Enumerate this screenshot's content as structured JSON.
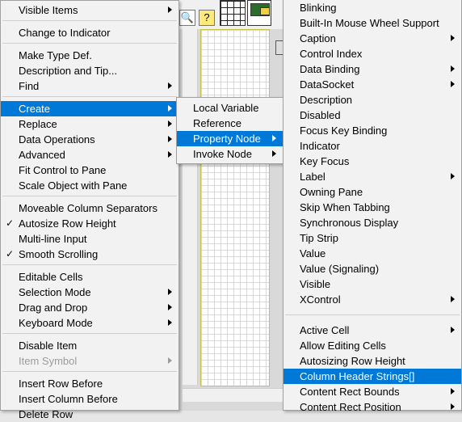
{
  "main_menu": {
    "items": [
      {
        "label": "Visible Items",
        "submenu": true
      },
      {
        "label": "Change to Indicator"
      },
      {
        "label": "Make Type Def."
      },
      {
        "label": "Description and Tip..."
      },
      {
        "label": "Find",
        "submenu": true
      },
      {
        "label": "Create",
        "submenu": true,
        "highlighted": true
      },
      {
        "label": "Replace",
        "submenu": true
      },
      {
        "label": "Data Operations",
        "submenu": true
      },
      {
        "label": "Advanced",
        "submenu": true
      },
      {
        "label": "Fit Control to Pane"
      },
      {
        "label": "Scale Object with Pane"
      },
      {
        "label": "Moveable Column Separators"
      },
      {
        "label": "Autosize Row Height",
        "checked": true
      },
      {
        "label": "Multi-line Input"
      },
      {
        "label": "Smooth Scrolling",
        "checked": true
      },
      {
        "label": "Editable Cells"
      },
      {
        "label": "Selection Mode",
        "submenu": true
      },
      {
        "label": "Drag and Drop",
        "submenu": true
      },
      {
        "label": "Keyboard Mode",
        "submenu": true
      },
      {
        "label": "Disable Item"
      },
      {
        "label": "Item Symbol",
        "submenu": true,
        "disabled": true
      },
      {
        "label": "Insert Row Before"
      },
      {
        "label": "Insert Column Before"
      },
      {
        "label": "Delete Row"
      }
    ]
  },
  "create_menu": {
    "items": [
      {
        "label": "Local Variable"
      },
      {
        "label": "Reference"
      },
      {
        "label": "Property Node",
        "submenu": true,
        "highlighted": true
      },
      {
        "label": "Invoke Node",
        "submenu": true
      }
    ]
  },
  "property_node_menu": {
    "items": [
      {
        "label": "Blinking"
      },
      {
        "label": "Built-In Mouse Wheel Support"
      },
      {
        "label": "Caption",
        "submenu": true
      },
      {
        "label": "Control Index"
      },
      {
        "label": "Data Binding",
        "submenu": true
      },
      {
        "label": "DataSocket",
        "submenu": true
      },
      {
        "label": "Description"
      },
      {
        "label": "Disabled"
      },
      {
        "label": "Focus Key Binding"
      },
      {
        "label": "Indicator"
      },
      {
        "label": "Key Focus"
      },
      {
        "label": "Label",
        "submenu": true
      },
      {
        "label": "Owning Pane"
      },
      {
        "label": "Skip When Tabbing"
      },
      {
        "label": "Synchronous Display"
      },
      {
        "label": "Tip Strip"
      },
      {
        "label": "Value"
      },
      {
        "label": "Value (Signaling)"
      },
      {
        "label": "Visible"
      },
      {
        "label": "XControl",
        "submenu": true
      },
      {
        "label": "Active Cell",
        "submenu": true
      },
      {
        "label": "Allow Editing Cells"
      },
      {
        "label": "Autosizing Row Height"
      },
      {
        "label": "Column Header Strings[]",
        "highlighted": true
      },
      {
        "label": "Content Rect Bounds",
        "submenu": true
      },
      {
        "label": "Content Rect Position",
        "submenu": true
      }
    ]
  },
  "toolbar": {
    "zoom_icon": "magnifier-icon",
    "help_icon": "help-icon",
    "help_glyph": "?",
    "connector_icon": "connector-pane-icon",
    "vi_icon": "vi-icon"
  },
  "colors": {
    "highlight": "#0078d7",
    "menu_bg": "#f2f2f2",
    "disabled": "#9c9c9c"
  }
}
